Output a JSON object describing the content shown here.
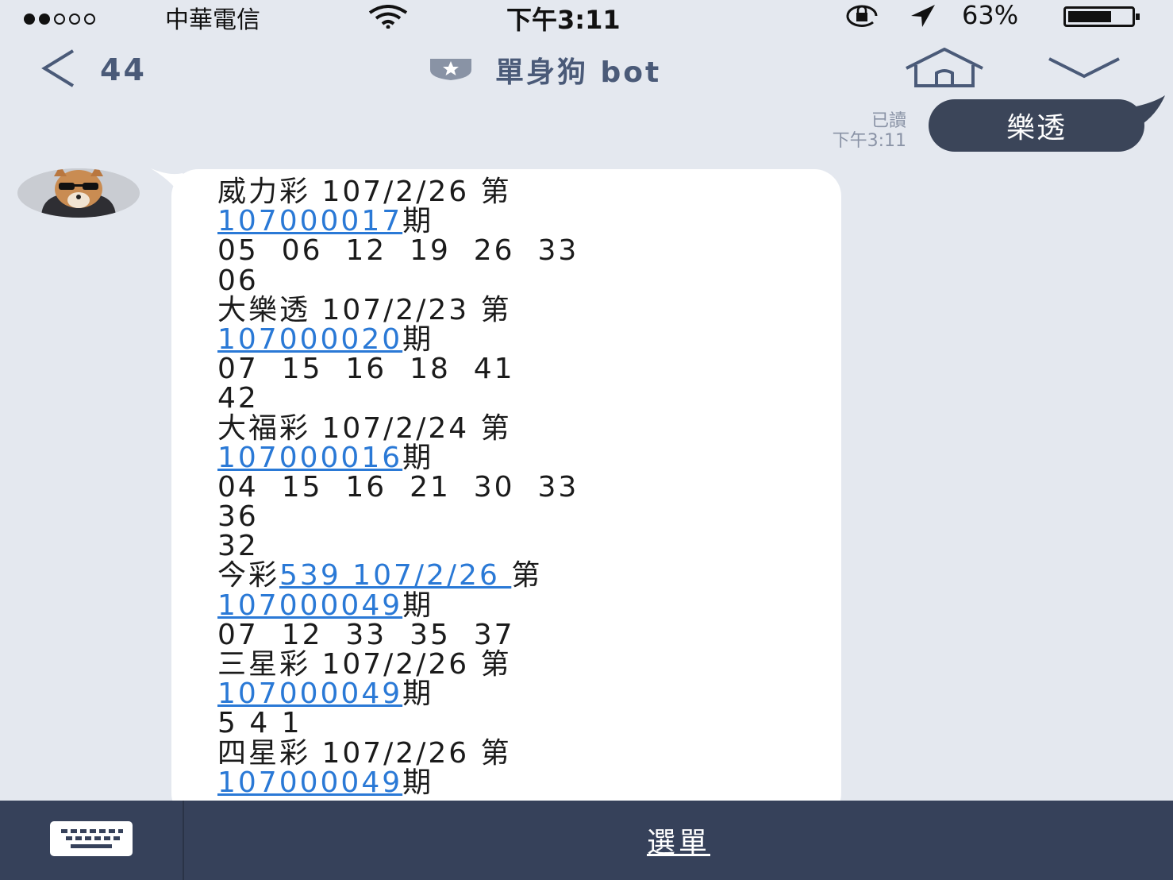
{
  "status_bar": {
    "carrier": "中華電信",
    "signal_dots": "●●○○○",
    "time": "下午3:11",
    "battery": "63%"
  },
  "header": {
    "back_count": "44",
    "title": "單身狗 bot"
  },
  "sent_message": {
    "text": "樂透",
    "read_label": "已讀",
    "time": "下午3:11"
  },
  "received_message": {
    "lines": [
      {
        "pre": "威力彩 107/2/26 第",
        "link": "",
        "post": ""
      },
      {
        "pre": "",
        "link": "107000017",
        "post": "期"
      },
      {
        "pre": "05  06  12  19  26  33",
        "link": "",
        "post": ""
      },
      {
        "pre": "06",
        "link": "",
        "post": ""
      },
      {
        "pre": "大樂透 107/2/23 第",
        "link": "",
        "post": ""
      },
      {
        "pre": "",
        "link": "107000020",
        "post": "期"
      },
      {
        "pre": "07  15  16  18  41",
        "link": "",
        "post": ""
      },
      {
        "pre": "42",
        "link": "",
        "post": ""
      },
      {
        "pre": "大福彩 107/2/24 第",
        "link": "",
        "post": ""
      },
      {
        "pre": "",
        "link": "107000016",
        "post": "期"
      },
      {
        "pre": "04  15  16  21  30  33",
        "link": "",
        "post": ""
      },
      {
        "pre": "36",
        "link": "",
        "post": ""
      },
      {
        "pre": "32",
        "link": "",
        "post": ""
      },
      {
        "pre": "今彩",
        "link": "539 107/2/26 ",
        "post": "第"
      },
      {
        "pre": "",
        "link": "107000049",
        "post": "期"
      },
      {
        "pre": "07  12  33  35  37",
        "link": "",
        "post": ""
      },
      {
        "pre": "三星彩 107/2/26 第",
        "link": "",
        "post": ""
      },
      {
        "pre": "",
        "link": "107000049",
        "post": "期"
      },
      {
        "pre": "5 4 1",
        "link": "",
        "post": ""
      },
      {
        "pre": "四星彩 107/2/26 第",
        "link": "",
        "post": ""
      },
      {
        "pre": "",
        "link": "107000049",
        "post": "期"
      }
    ]
  },
  "bottom_bar": {
    "menu_label": "選單"
  },
  "colors": {
    "background": "#e4e8ef",
    "sent_bubble": "#3b4559",
    "link": "#2a79d6",
    "bottom_bar": "#36415a",
    "header_text": "#4a5a78"
  },
  "icons": [
    "wifi-icon",
    "rotation-lock-icon",
    "location-arrow-icon",
    "battery-icon",
    "back-chevron-icon",
    "official-badge-icon",
    "home-icon",
    "chevron-down-icon",
    "keyboard-icon",
    "avatar-dog"
  ]
}
